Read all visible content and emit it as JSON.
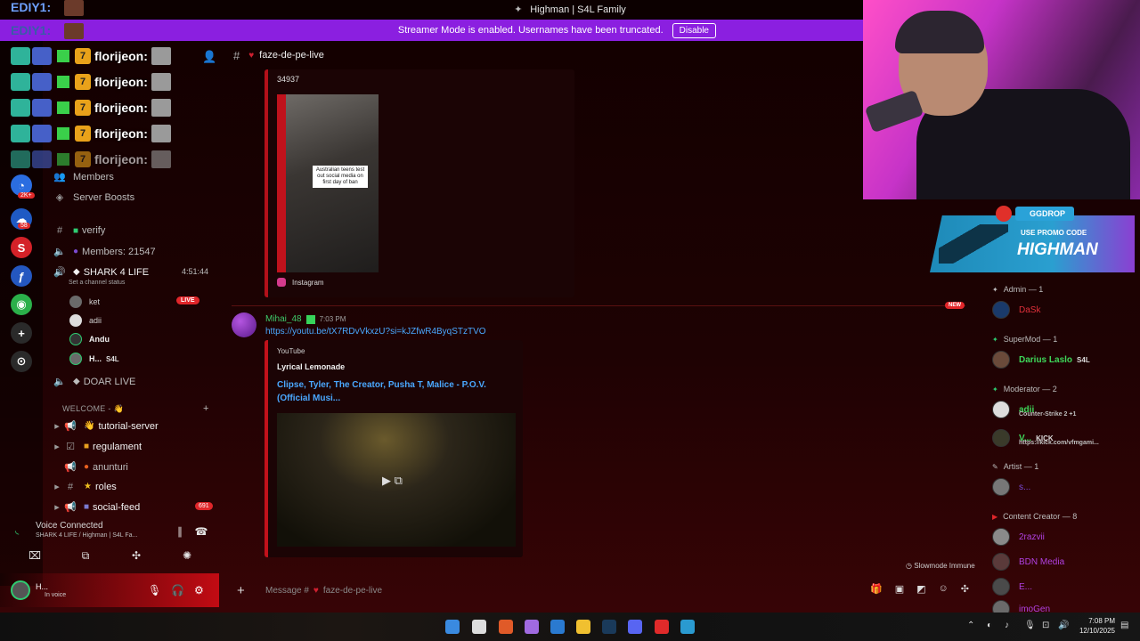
{
  "window": {
    "title": "Highman | S4L Family"
  },
  "streamer_banner": {
    "text": "Streamer Mode is enabled. Usernames have been truncated.",
    "button": "Disable"
  },
  "overlay_chat": {
    "header": "EDIY1:",
    "header_ghost": "EDIY1:",
    "messages": [
      {
        "user": "florijeon:"
      },
      {
        "user": "florijeon:"
      },
      {
        "user": "florijeon:"
      },
      {
        "user": "florijeon:"
      },
      {
        "user": "florijeon:"
      }
    ]
  },
  "server_rail": {
    "badges": [
      "2K+",
      "58"
    ],
    "accent": "#e02a2a"
  },
  "sidebar": {
    "members_label": "Members",
    "boosts_label": "Server Boosts",
    "channels": {
      "verify": "verify",
      "members_count": "Members: 21547",
      "voice_channel": "SHARK 4 LIFE",
      "voice_timer": "4:51:44",
      "set_status": "Set a channel status",
      "doar_live": "DOAR LIVE"
    },
    "voice_users": [
      {
        "name": "ket",
        "live": "LIVE"
      },
      {
        "name": "adii"
      },
      {
        "name": "Andu"
      },
      {
        "name": "H...",
        "tag": "S4L"
      }
    ],
    "category": "WELCOME - 👋",
    "text_channels": [
      {
        "name": "tutorial-server"
      },
      {
        "name": "regulament"
      },
      {
        "name": "anunturi"
      },
      {
        "name": "roles"
      },
      {
        "name": "social-feed",
        "badge": "691"
      }
    ]
  },
  "voice_panel": {
    "title": "Voice Connected",
    "subtitle": "SHARK 4 LIFE / Highman | S4L Fa..."
  },
  "user_panel": {
    "username": "H...",
    "status": "In voice"
  },
  "chat": {
    "channel_name": "faze-de-pe-live",
    "embed1": {
      "number": "34937",
      "caption": "Australian teens test out social media on first day of ban",
      "provider": "Instagram"
    },
    "new_badge": "NEW",
    "message": {
      "user": "Mihai_48",
      "time": "7:03 PM",
      "link": "https://youtu.be/tX7RDvVkxzU?si=kJZfwR4ByqSTzTVO"
    },
    "embed2": {
      "provider": "YouTube",
      "author": "Lyrical Lemonade",
      "title": "Clipse, Tyler, The Creator, Pusha T, Malice - P.O.V. (Official Musi..."
    },
    "slowmode": "Slowmode Immune",
    "composer_placeholder": "Message #",
    "composer_channel": "faze-de-pe-live"
  },
  "promo": {
    "brand": "GGDROP",
    "use": "USE PROMO CODE",
    "code": "HIGHMAN"
  },
  "members": {
    "roles": [
      {
        "name": "Admin — 1"
      },
      {
        "name": "SuperMod — 1"
      },
      {
        "name": "Moderator — 2"
      },
      {
        "name": "Artist — 1"
      },
      {
        "name": "Content Creator — 8"
      }
    ],
    "list": {
      "dask": "DaSk",
      "darius": "Darius Laslo",
      "darius_tag": "S4L",
      "adii": "adii",
      "adii_sub": "Counter-Strike 2 +1",
      "v_user": "V...",
      "v_tag": "KICK",
      "v_sub": "https://kick.com/vfmgami...",
      "artist": "s...",
      "c1": "2razvii",
      "c2": "BDN Media",
      "c3": "E...",
      "c4": "imoGen"
    }
  },
  "taskbar": {
    "time": "7:08 PM",
    "date": "12/10/2025"
  }
}
